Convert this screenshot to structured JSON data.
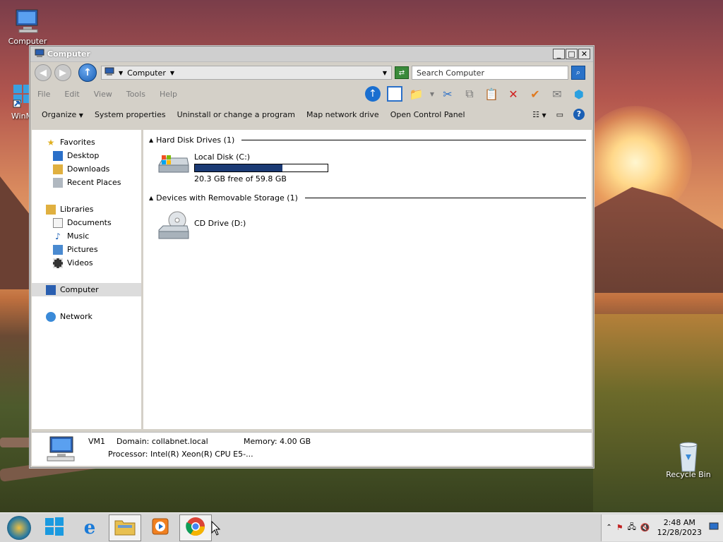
{
  "desktop": {
    "icons": [
      {
        "label": "Computer"
      },
      {
        "label": "WinM"
      },
      {
        "label": "Recycle Bin"
      }
    ]
  },
  "window": {
    "title": "Computer",
    "controls": {
      "minimize": "_",
      "maximize": "□",
      "close": "✕"
    },
    "address": {
      "location": "Computer"
    },
    "search": {
      "placeholder": "Search Computer"
    },
    "menu": [
      "File",
      "Edit",
      "View",
      "Tools",
      "Help"
    ],
    "commands": [
      "Organize",
      "System properties",
      "Uninstall or change a program",
      "Map network drive",
      "Open Control Panel"
    ],
    "nav": {
      "favorites": "Favorites",
      "desktop": "Desktop",
      "downloads": "Downloads",
      "recent": "Recent Places",
      "libraries": "Libraries",
      "documents": "Documents",
      "music": "Music",
      "pictures": "Pictures",
      "videos": "Videos",
      "computer": "Computer",
      "network": "Network"
    },
    "groups": {
      "hdd": "Hard Disk Drives (1)",
      "removable": "Devices with Removable Storage (1)"
    },
    "drives": {
      "c": {
        "label": "Local Disk (C:)",
        "free_text": "20.3 GB free of 59.8 GB",
        "used_fraction": 0.66
      },
      "d": {
        "label": "CD Drive (D:)"
      }
    },
    "details": {
      "name": "VM1",
      "domain": "Domain: collabnet.local",
      "memory": "Memory: 4.00 GB",
      "processor": "Processor: Intel(R) Xeon(R) CPU E5-..."
    }
  },
  "taskbar": {
    "clock_time": "2:48 AM",
    "clock_date": "12/28/2023"
  },
  "colors": {
    "accent": "#1b3a74",
    "taskbar": "#d6d6d6",
    "window_frame": "#d4d0c8"
  }
}
